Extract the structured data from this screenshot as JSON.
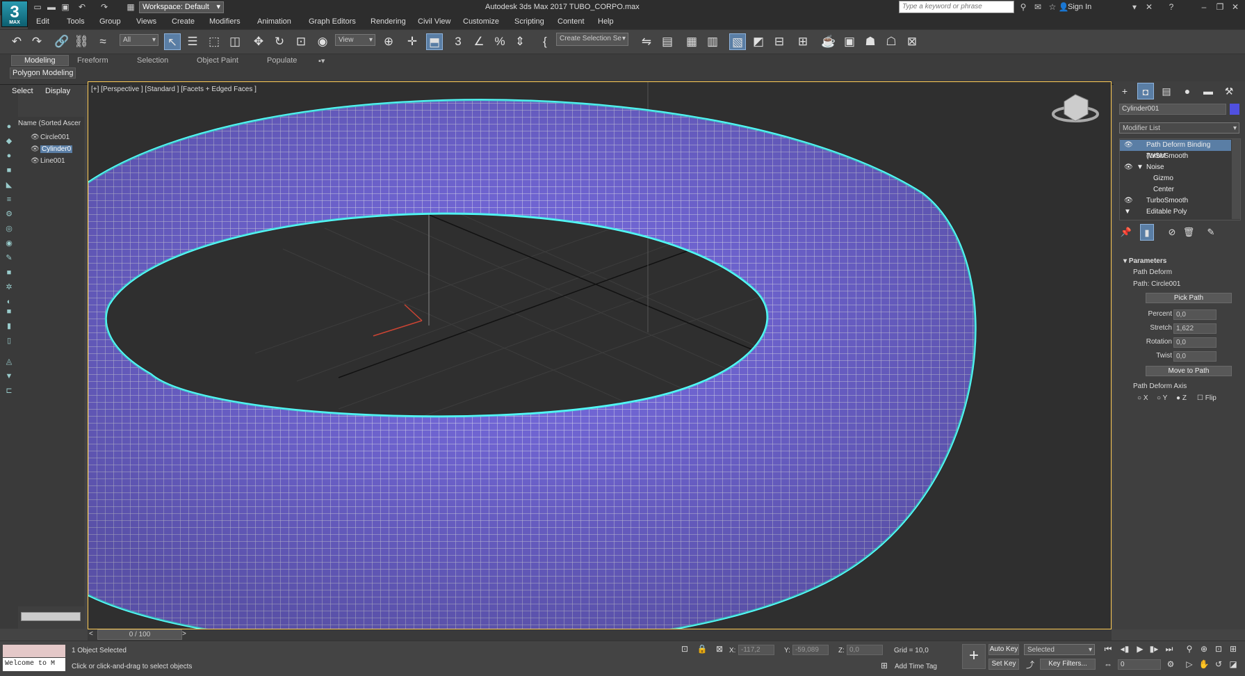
{
  "app": {
    "logo_text": "3",
    "logo_sub": "MAX",
    "title": "Autodesk 3ds Max 2017    TUBO_CORPO.max",
    "workspace": "Workspace: Default",
    "search_placeholder": "Type a keyword or phrase",
    "sign_in": "Sign In"
  },
  "menu": [
    "Edit",
    "Tools",
    "Group",
    "Views",
    "Create",
    "Modifiers",
    "Animation",
    "Graph Editors",
    "Rendering",
    "Civil View",
    "Customize",
    "Scripting",
    "Content",
    "Help"
  ],
  "toolbar": {
    "filter": "All",
    "view": "View",
    "selection_set": "Create Selection Se"
  },
  "ribbon": {
    "tabs": [
      "Modeling",
      "Freeform",
      "Selection",
      "Object Paint",
      "Populate"
    ],
    "active": "Modeling",
    "panel": "Polygon Modeling"
  },
  "explorer": {
    "tabs": [
      "Select",
      "Display"
    ],
    "header": "Name (Sorted Ascer",
    "objects": [
      "Circle001",
      "Cylinder0",
      "Line001"
    ]
  },
  "viewport": {
    "label": "[+] [Perspective ] [Standard ] [Facets + Edged Faces ]",
    "mesh_color": "#7b6fe8"
  },
  "command_panel": {
    "object_name": "Cylinder001",
    "object_color": "#5050e0",
    "modifier_list": "Modifier List",
    "stack": [
      {
        "label": "Path Deform Binding (WSM",
        "eye": true,
        "indent": 0,
        "selected": true
      },
      {
        "label": "TurboSmooth",
        "eye": false,
        "indent": 0
      },
      {
        "label": "Noise",
        "eye": true,
        "indent": 0,
        "expand": "▼"
      },
      {
        "label": "Gizmo",
        "eye": false,
        "indent": 1
      },
      {
        "label": "Center",
        "eye": false,
        "indent": 1
      },
      {
        "label": "TurboSmooth",
        "eye": true,
        "indent": 0
      },
      {
        "label": "Editable Poly",
        "eye": false,
        "indent": 0,
        "expand": "▼"
      }
    ],
    "rollout": "Parameters",
    "group": "Path Deform",
    "path": "Path: Circle001",
    "pick_path": "Pick Path",
    "params": [
      {
        "label": "Percent",
        "value": "0,0"
      },
      {
        "label": "Stretch",
        "value": "1,622"
      },
      {
        "label": "Rotation",
        "value": "0,0"
      },
      {
        "label": "Twist",
        "value": "0,0"
      }
    ],
    "move_to_path": "Move to Path",
    "axis_label": "Path Deform Axis",
    "axes": [
      "X",
      "Y",
      "Z"
    ],
    "axis_selected": "Z",
    "flip": "Flip"
  },
  "timeline": {
    "frame": "0 / 100"
  },
  "status": {
    "selected": "1 Object Selected",
    "prompt": "Click or click-and-drag to select objects",
    "welcome": "Welcome to M",
    "x_label": "X:",
    "x": "-117,2",
    "y_label": "Y:",
    "y": "-59,089",
    "z_label": "Z:",
    "z": "0,0",
    "grid": "Grid = 10,0",
    "add_time_tag": "Add Time Tag",
    "auto_key": "Auto Key",
    "set_key": "Set Key",
    "selected_mode": "Selected",
    "key_filters": "Key Filters...",
    "frame_value": "0"
  }
}
